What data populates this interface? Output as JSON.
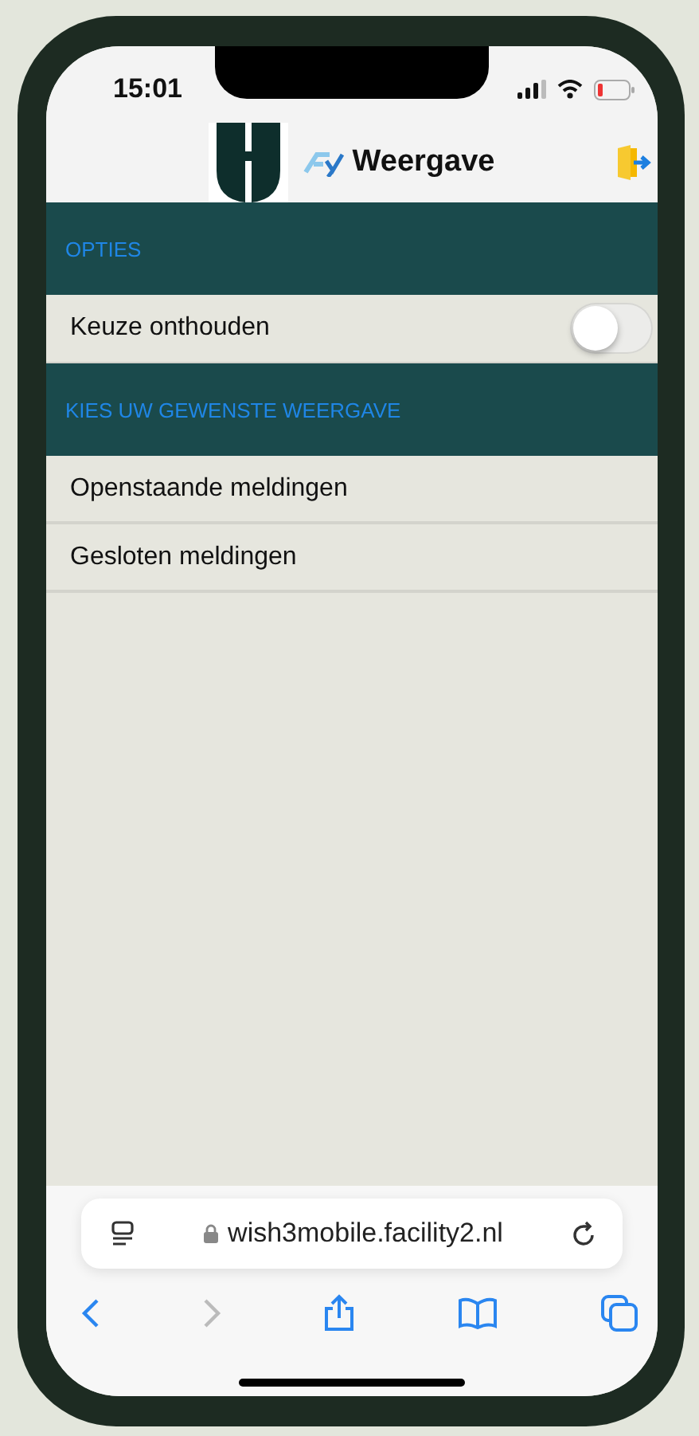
{
  "status_bar": {
    "time": "15:01"
  },
  "header": {
    "title": "Weergave"
  },
  "sections": [
    {
      "title": "OPTIES",
      "rows": [
        {
          "kind": "toggle",
          "label": "Keuze onthouden",
          "on": false
        }
      ]
    },
    {
      "title": "KIES UW GEWENSTE WEERGAVE",
      "rows": [
        {
          "kind": "link",
          "label": "Openstaande meldingen"
        },
        {
          "kind": "link",
          "label": "Gesloten meldingen"
        }
      ]
    }
  ],
  "browser": {
    "url": "wish3mobile.facility2.nl",
    "back_disabled": false,
    "forward_disabled": true
  }
}
